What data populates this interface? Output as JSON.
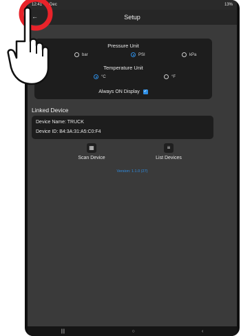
{
  "status_bar": {
    "time": "12:41",
    "date": "5 Dec",
    "battery": "13%"
  },
  "app_bar": {
    "title": "Setup",
    "back_icon": "back-arrow-icon"
  },
  "units": {
    "pressure_title": "Pressure Unit",
    "pressure_options": [
      "bar",
      "PSI",
      "kPa"
    ],
    "pressure_selected": "PSI",
    "temperature_title": "Temperature Unit",
    "temperature_options": [
      "°C",
      "°F"
    ],
    "temperature_selected": "°C",
    "always_on_label": "Always ON Display",
    "always_on_checked": true
  },
  "linked_device": {
    "section_title": "Linked Device",
    "name_line": "Device Name: TRUCK",
    "id_line": "Device ID: B4:3A:31:A5:C0:F4"
  },
  "actions": {
    "scan_label": "Scan Device",
    "list_label": "List Devices",
    "scan_icon": "qr-code-icon",
    "list_icon": "list-icon"
  },
  "version": "Version: 1.1.0 (27)",
  "colors": {
    "accent": "#2e8fe6",
    "card": "#1d1d1d",
    "background": "#3a3a3a",
    "highlight_circle": "#e8232a"
  }
}
